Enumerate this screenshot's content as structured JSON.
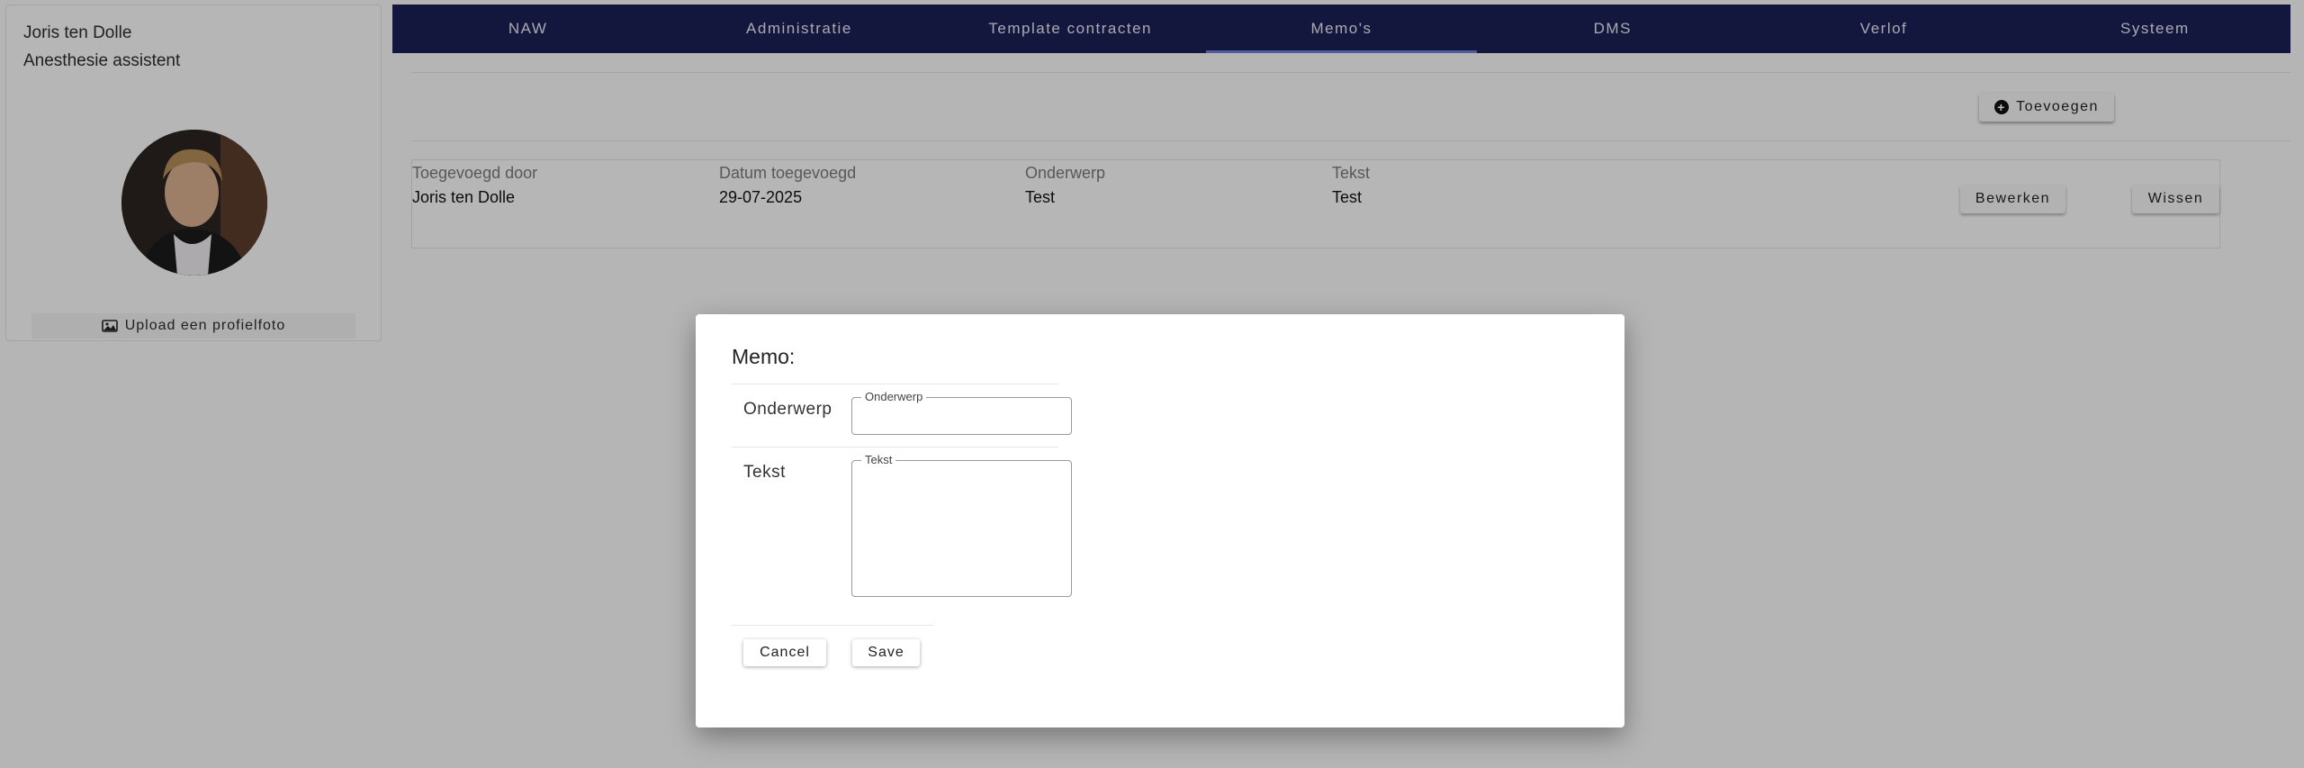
{
  "profile": {
    "name": "Joris ten Dolle",
    "role": "Anesthesie assistent",
    "upload_label": "Upload een profielfoto"
  },
  "nav": {
    "tabs": [
      "NAW",
      "Administratie",
      "Template contracten",
      "Memo's",
      "DMS",
      "Verlof",
      "Systeem"
    ],
    "active": "Memo's"
  },
  "toolbar": {
    "add_label": "Toevoegen"
  },
  "memo_table": {
    "headers": [
      "Toegevoegd door",
      "Datum toegevoegd",
      "Onderwerp",
      "Tekst"
    ],
    "rows": [
      {
        "added_by": "Joris ten Dolle",
        "date": "29-07-2025",
        "subject": "Test",
        "text": "Test"
      }
    ],
    "edit_label": "Bewerken",
    "delete_label": "Wissen"
  },
  "modal": {
    "title": "Memo:",
    "subject_label": "Onderwerp",
    "subject_legend": "Onderwerp",
    "subject_value": "",
    "text_label": "Tekst",
    "text_legend": "Tekst",
    "text_value": "",
    "cancel_label": "Cancel",
    "save_label": "Save"
  },
  "colors": {
    "nav_bg": "#1c2053",
    "nav_active_underline": "#6d7fd6",
    "overlay": "rgba(0,0,0,0.26)"
  }
}
